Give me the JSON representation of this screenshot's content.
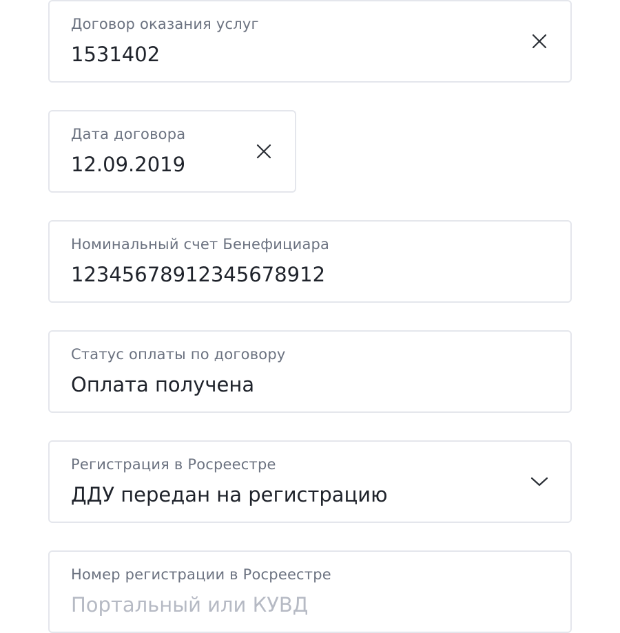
{
  "form": {
    "fields": [
      {
        "label": "Договор оказания услуг",
        "value": "1531402",
        "icon": "close-icon"
      },
      {
        "label": "Дата договора",
        "value": "12.09.2019",
        "icon": "close-icon"
      },
      {
        "label": "Номинальный счет Бенефициара",
        "value": "12345678912345678912"
      },
      {
        "label": "Статус оплаты по договору",
        "value": "Оплата получена"
      },
      {
        "label": "Регистрация в Росреестре",
        "value": "ДДУ передан на регистрацию",
        "icon": "chevron-down-icon"
      },
      {
        "label": "Номер регистрации в Росреестре",
        "value": "",
        "placeholder": "Портальный или КУВД"
      }
    ]
  },
  "colors": {
    "border": "#e4e6ec",
    "label": "#6b7280",
    "value": "#1f232b",
    "placeholder": "#b6bac4",
    "icon": "#2b2f36"
  }
}
